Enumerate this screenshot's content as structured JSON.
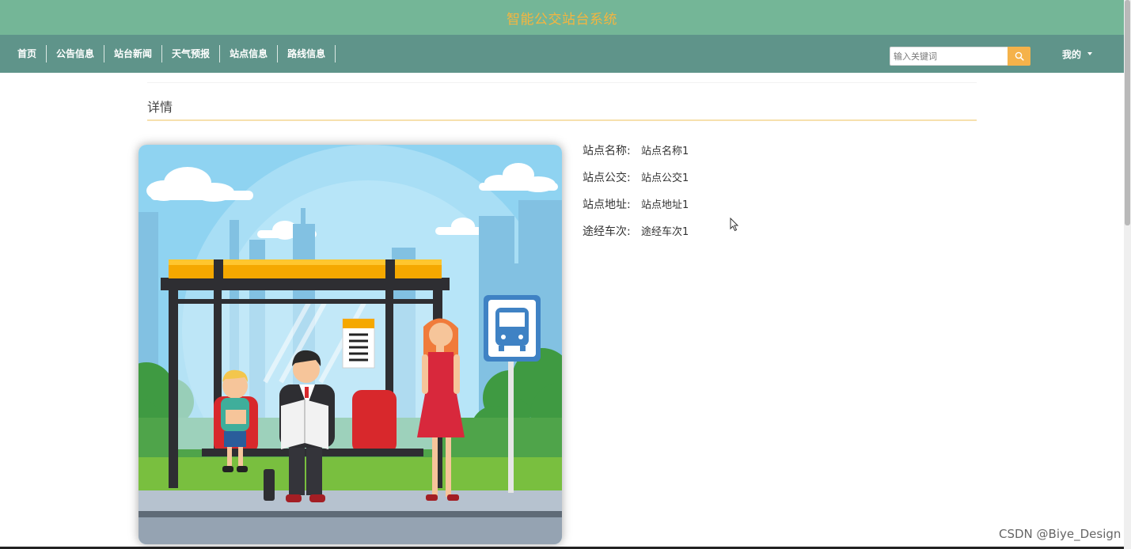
{
  "header": {
    "title": "智能公交站台系统"
  },
  "nav": {
    "items": [
      {
        "label": "首页"
      },
      {
        "label": "公告信息"
      },
      {
        "label": "站台新闻"
      },
      {
        "label": "天气预报"
      },
      {
        "label": "站点信息"
      },
      {
        "label": "路线信息"
      }
    ],
    "search": {
      "placeholder": "输入关键词",
      "icon": "search-icon"
    },
    "user_menu": {
      "label": "我的",
      "icon": "caret-down-icon"
    }
  },
  "main": {
    "section_title": "详情",
    "image": {
      "description_icon": "bus-stop-illustration"
    },
    "details": [
      {
        "label": "站点名称:",
        "value": "站点名称1"
      },
      {
        "label": "站点公交:",
        "value": "站点公交1"
      },
      {
        "label": "站点地址:",
        "value": "站点地址1"
      },
      {
        "label": "途经车次:",
        "value": "途经车次1"
      }
    ]
  },
  "watermark": "CSDN @Biye_Design",
  "colors": {
    "topbar": "#74b697",
    "navbar": "#5f948a",
    "title_text": "#f5b53f",
    "search_button": "#f5b24a",
    "title_underline": "#f6e0ad"
  }
}
